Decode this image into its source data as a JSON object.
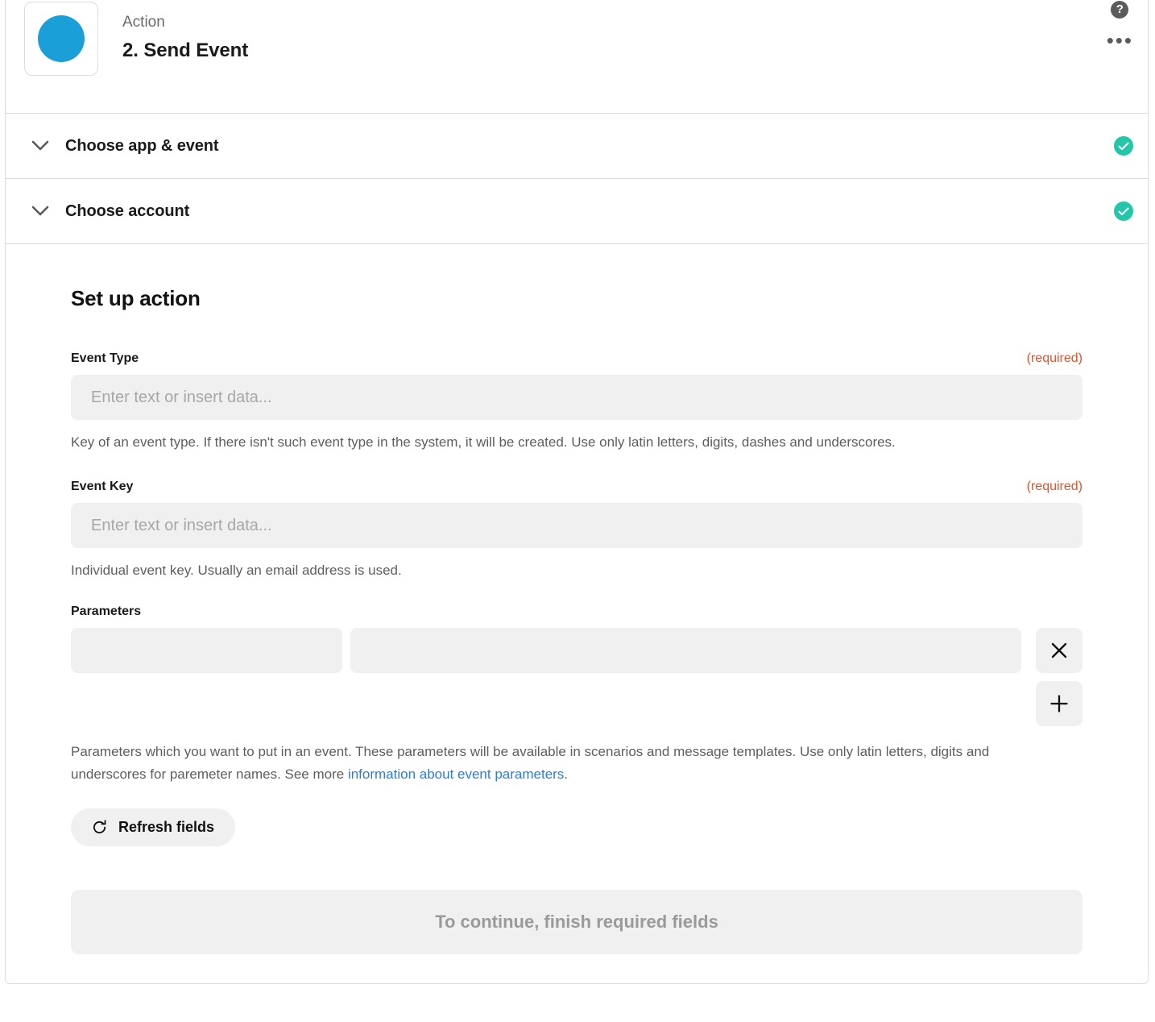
{
  "header": {
    "kicker": "Action",
    "title": "2. Send Event",
    "app_icon": "blue-circle-app-icon",
    "help_glyph": "?",
    "more_glyph": "•••",
    "accent_color": "#1b9fd8"
  },
  "steps": [
    {
      "label": "Choose app & event",
      "status": "complete",
      "status_color": "#21c7a8"
    },
    {
      "label": "Choose account",
      "status": "complete",
      "status_color": "#21c7a8"
    }
  ],
  "setup": {
    "title": "Set up action",
    "required_tag": "(required)",
    "fields": {
      "event_type": {
        "label": "Event Type",
        "value": "",
        "placeholder": "Enter text or insert data...",
        "help": "Key of an event type. If there isn't such event type in the system, it will be created. Use only latin letters, digits, dashes and underscores."
      },
      "event_key": {
        "label": "Event Key",
        "value": "",
        "placeholder": "Enter text or insert data...",
        "help": "Individual event key. Usually an email address is used."
      },
      "parameters": {
        "label": "Parameters",
        "rows": [
          {
            "key": "",
            "value": "",
            "key_placeholder": "",
            "value_placeholder": ""
          }
        ],
        "remove_glyph": "close-icon",
        "add_glyph": "plus-icon",
        "help_before_link": "Parameters which you want to put in an event. These parameters will be available in scenarios and message templates. Use only latin letters, digits and underscores for paremeter names. See more ",
        "help_link": "information about event parameters",
        "help_after_link": ".",
        "link_color": "#2a7de1"
      }
    },
    "refresh_button": "Refresh fields",
    "continue_button": "To continue, finish required fields"
  }
}
